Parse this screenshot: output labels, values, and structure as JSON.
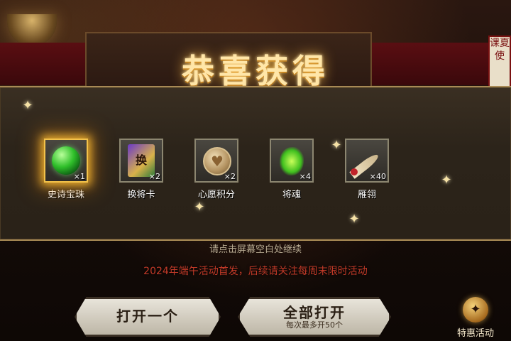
{
  "title": "恭喜获得",
  "side_scroll_text": "课夏使",
  "rewards": [
    {
      "name": "史诗宝珠",
      "count": "×1",
      "icon": "green-pearl-icon",
      "rarity": "epic"
    },
    {
      "name": "换将卡",
      "count": "×2",
      "icon": "general-swap-card-icon",
      "card_glyph": "换"
    },
    {
      "name": "心愿积分",
      "count": "×2",
      "icon": "wish-points-coin-icon",
      "coin_glyph": "♥"
    },
    {
      "name": "将魂",
      "count": "×4",
      "icon": "general-soul-icon"
    },
    {
      "name": "雁翎",
      "count": "×40",
      "icon": "goose-feather-icon"
    }
  ],
  "hint_text": "请点击屏幕空白处继续",
  "notice_text": "2024年端午活动首发，后续请关注每周末限时活动",
  "buttons": {
    "open_one": {
      "label": "打开一个"
    },
    "open_all": {
      "label": "全部打开",
      "sublabel": "每次最多开50个"
    }
  },
  "special_event": {
    "label": "特惠活动",
    "icon": "special-offer-icon",
    "glyph": "✦"
  },
  "colors": {
    "title_glow": "#ffe6a8",
    "notice": "#c23a28",
    "epic_border": "#f3c24a"
  }
}
